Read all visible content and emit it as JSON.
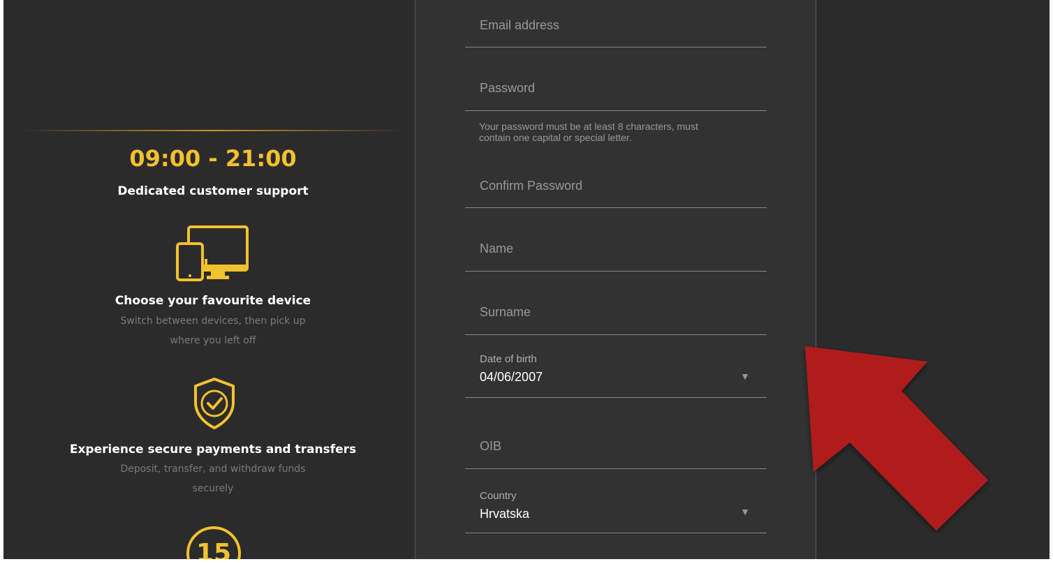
{
  "promo": {
    "hours": "09:00 - 21:00",
    "support_title": "Dedicated customer support",
    "device_title": "Choose your favourite device",
    "device_desc_1": "Switch between devices, then pick up",
    "device_desc_2": "where you left off",
    "secure_title": "Experience secure payments and transfers",
    "secure_desc_1": "Deposit, transfer, and withdraw funds",
    "secure_desc_2": "securely",
    "badge_number": "15",
    "icons": [
      "devices-icon",
      "shield-check-icon",
      "number-badge-icon"
    ],
    "accent_color": "#f2c12e"
  },
  "form": {
    "email_placeholder": "Email address",
    "password_placeholder": "Password",
    "password_hint_1": "Your password must be at least 8 characters, must",
    "password_hint_2": "contain one capital or special letter.",
    "confirm_password_placeholder": "Confirm Password",
    "name_placeholder": "Name",
    "surname_placeholder": "Surname",
    "dob_label": "Date of birth",
    "dob_value": "04/06/2007",
    "oib_placeholder": "OIB",
    "country_label": "Country",
    "country_value": "Hrvatska",
    "caret_glyph": "▼"
  },
  "annotation": {
    "arrow_color": "#b01e1e",
    "arrow_icon": "red-arrow-icon"
  }
}
